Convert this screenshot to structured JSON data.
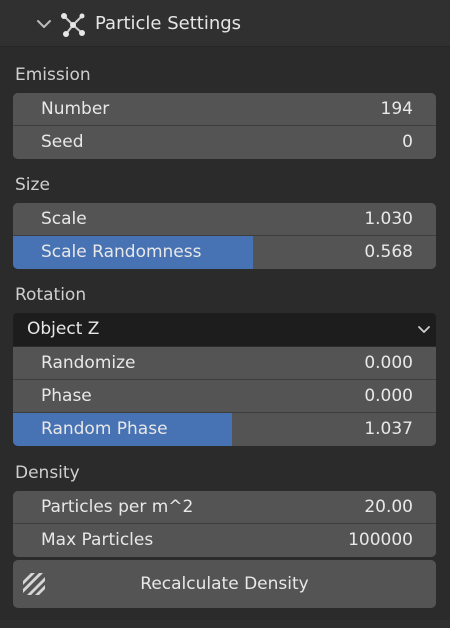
{
  "panel": {
    "title": "Particle Settings"
  },
  "emission": {
    "label": "Emission",
    "number": {
      "label": "Number",
      "value": "194"
    },
    "seed": {
      "label": "Seed",
      "value": "0"
    }
  },
  "size": {
    "label": "Size",
    "scale": {
      "label": "Scale",
      "value": "1.030"
    },
    "scale_randomness": {
      "label": "Scale Randomness",
      "value": "0.568",
      "fill_fraction": 0.568
    }
  },
  "rotation": {
    "label": "Rotation",
    "axis": {
      "selected": "Object Z"
    },
    "randomize": {
      "label": "Randomize",
      "value": "0.000"
    },
    "phase": {
      "label": "Phase",
      "value": "0.000"
    },
    "random_phase": {
      "label": "Random Phase",
      "value": "1.037",
      "fill_fraction": 0.5185
    }
  },
  "density": {
    "label": "Density",
    "particles_per_m2": {
      "label": "Particles per m^2",
      "value": "20.00"
    },
    "max_particles": {
      "label": "Max Particles",
      "value": "100000"
    },
    "recalculate_button": {
      "label": "Recalculate Density"
    }
  },
  "colors": {
    "accent": "#4772b3",
    "field": "#545454",
    "background": "#2b2b2b",
    "dropdown": "#1d1d1d"
  }
}
